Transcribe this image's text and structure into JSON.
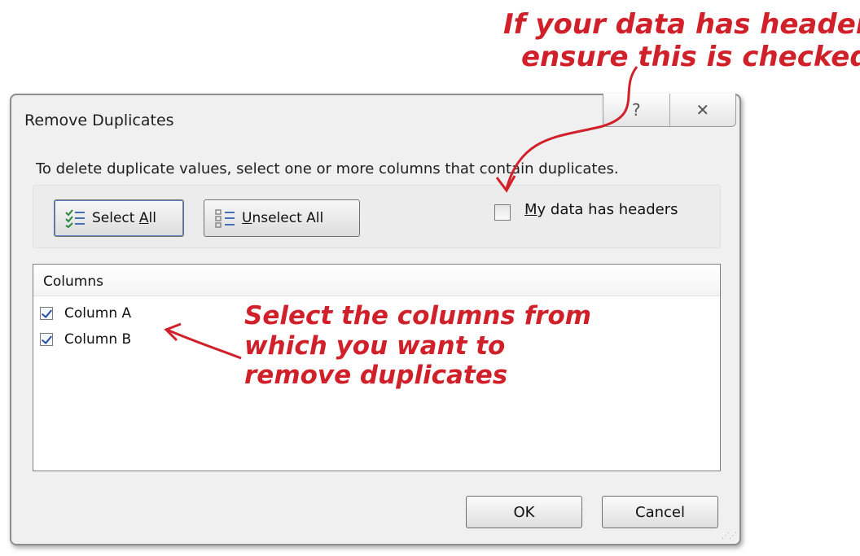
{
  "dialog": {
    "title": "Remove Duplicates",
    "help_glyph": "?",
    "close_glyph": "✕",
    "prompt": "To delete duplicate values, select one or more columns that contain duplicates.",
    "select_all_pre": "Select ",
    "select_all_key": "A",
    "select_all_post": "ll",
    "unselect_key": "U",
    "unselect_post": "nselect All",
    "headers_key": "M",
    "headers_post": "y data has headers",
    "headers_checked": false,
    "columns_header": "Columns",
    "columns": [
      {
        "label": "Column A",
        "checked": true
      },
      {
        "label": "Column B",
        "checked": true
      }
    ],
    "ok_label": "OK",
    "cancel_label": "Cancel"
  },
  "annotations": {
    "top_line1": "If your data has headers,",
    "top_line2": "ensure this is checked",
    "mid_line1": "Select the columns from",
    "mid_line2": "which you want to",
    "mid_line3": "remove duplicates",
    "color": "#d0202a"
  }
}
